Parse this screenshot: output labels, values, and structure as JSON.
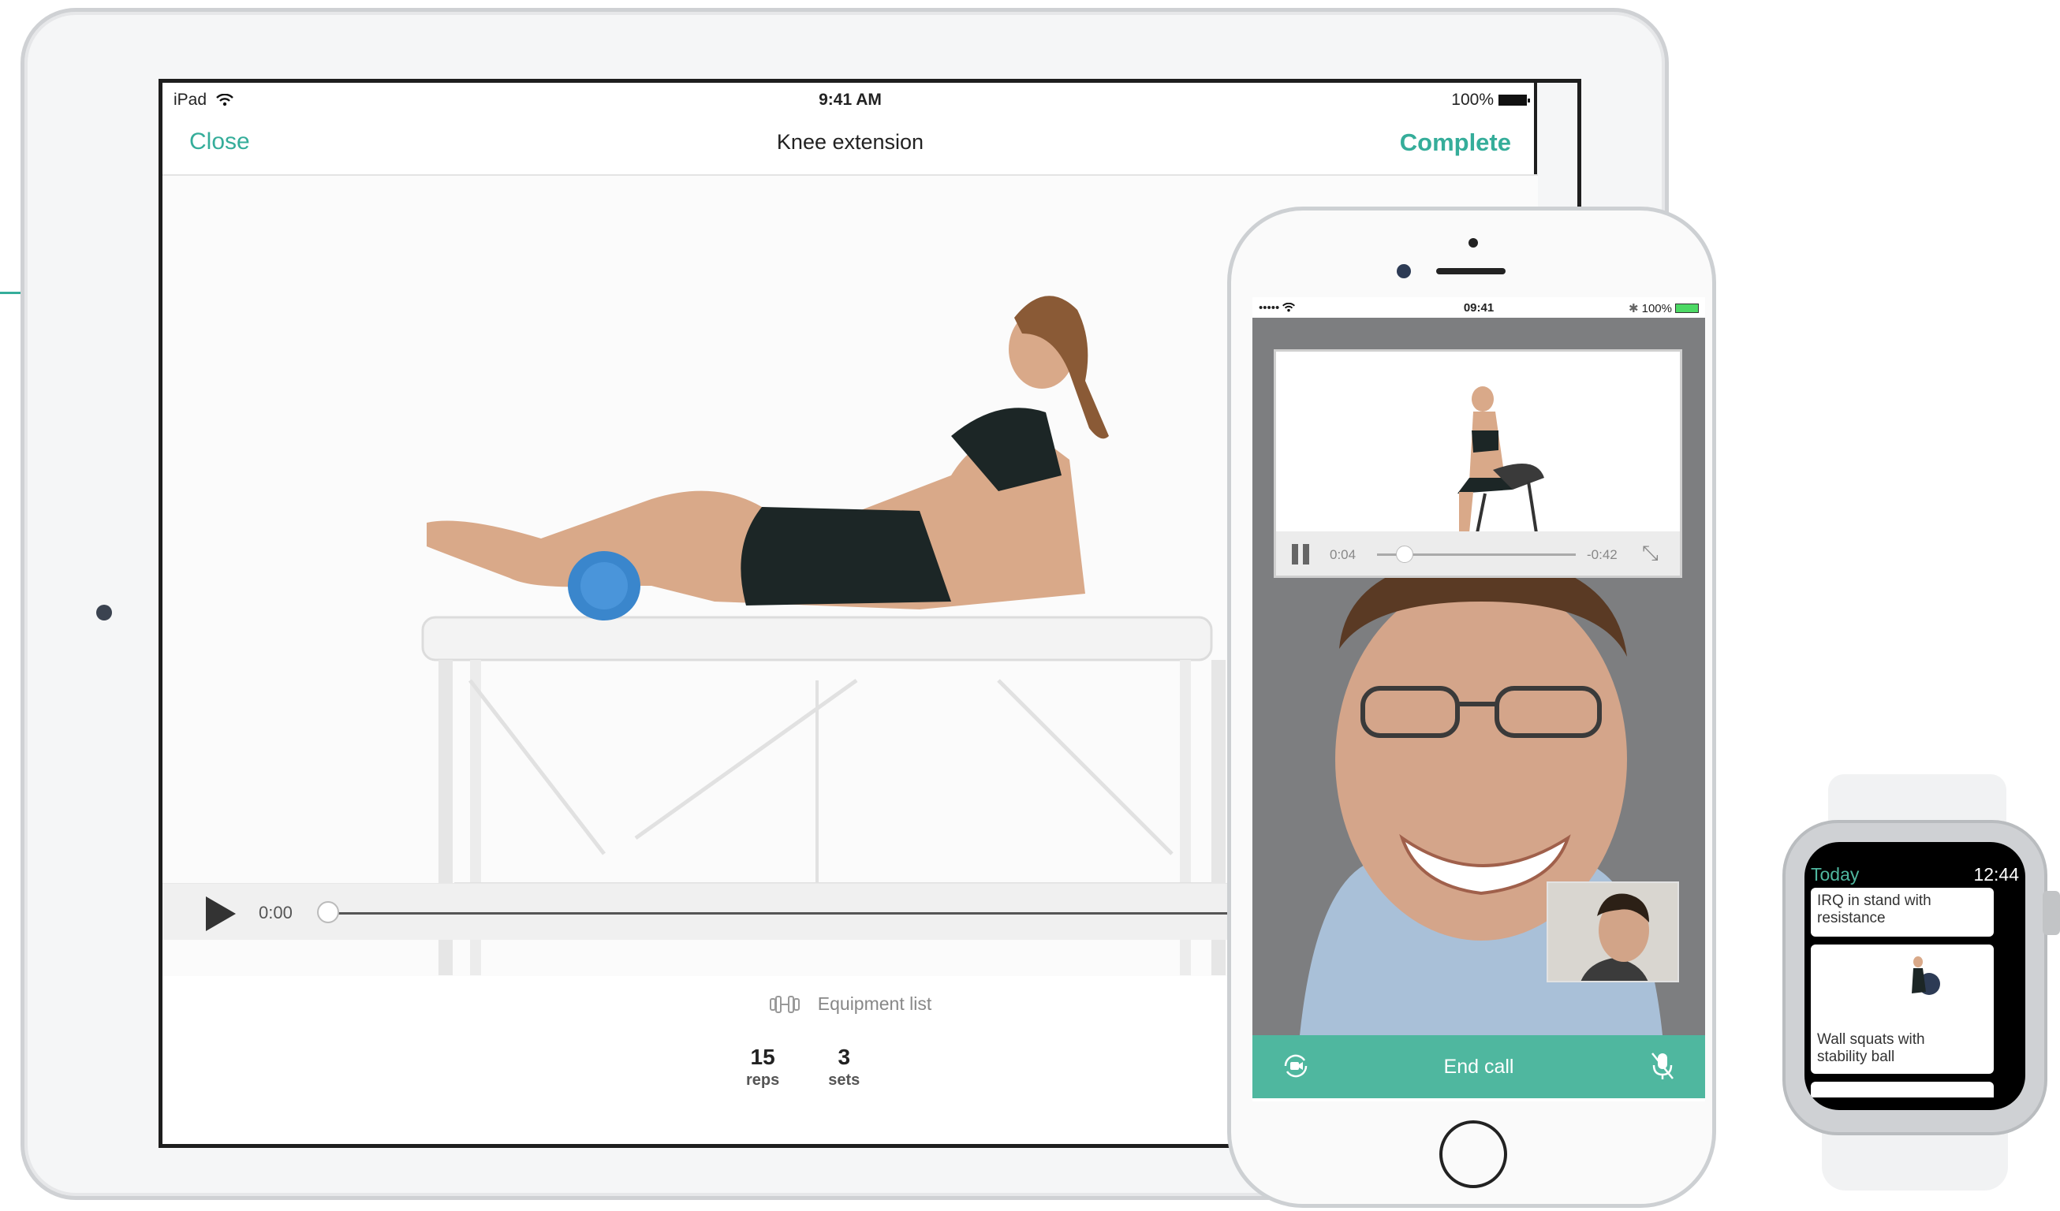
{
  "ipad": {
    "status": {
      "carrier": "iPad",
      "time": "9:41 AM",
      "battery": "100%"
    },
    "nav": {
      "close": "Close",
      "title": "Knee extension",
      "complete": "Complete"
    },
    "player": {
      "time": "0:00"
    },
    "equipment_label": "Equipment list",
    "stats": [
      {
        "value": "15",
        "label": "reps"
      },
      {
        "value": "3",
        "label": "sets"
      }
    ]
  },
  "iphone": {
    "status": {
      "signal": "•••••",
      "time": "09:41",
      "battery": "100%"
    },
    "player": {
      "elapsed": "0:04",
      "remaining": "-0:42"
    },
    "end_call": "End call"
  },
  "watch": {
    "header": "Today",
    "time": "12:44",
    "cards": [
      {
        "label": "IRQ in stand with resistance"
      },
      {
        "label": "Wall squats with stability ball"
      }
    ]
  },
  "colors": {
    "accent": "#35ad9a",
    "call_bar": "#4fb79f"
  }
}
